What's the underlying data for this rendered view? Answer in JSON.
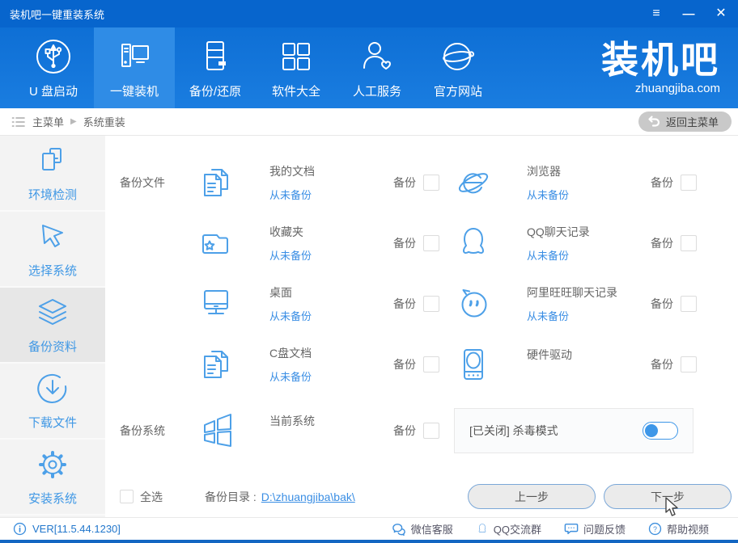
{
  "titlebar": {
    "title": "装机吧一键重装系统"
  },
  "nav": {
    "items": [
      {
        "label": "U 盘启动",
        "icon": "usb-boot-icon",
        "active": false
      },
      {
        "label": "一键装机",
        "icon": "one-click-install-icon",
        "active": true
      },
      {
        "label": "备份/还原",
        "icon": "backup-restore-icon",
        "active": false
      },
      {
        "label": "软件大全",
        "icon": "software-collection-icon",
        "active": false
      },
      {
        "label": "人工服务",
        "icon": "human-service-icon",
        "active": false
      },
      {
        "label": "官方网站",
        "icon": "official-website-icon",
        "active": false
      }
    ],
    "logo": {
      "text": "装机吧",
      "domain": "zhuangjiba.com"
    }
  },
  "breadcrumb": {
    "root": "主菜单",
    "current": "系统重装",
    "back": "返回主菜单"
  },
  "sidebar": [
    {
      "label": "环境检测",
      "icon": "environment-check-icon",
      "active": false
    },
    {
      "label": "选择系统",
      "icon": "select-system-icon",
      "active": false
    },
    {
      "label": "备份资料",
      "icon": "backup-data-icon",
      "active": true
    },
    {
      "label": "下载文件",
      "icon": "download-files-icon",
      "active": false
    },
    {
      "label": "安装系统",
      "icon": "install-system-icon",
      "active": false
    }
  ],
  "content": {
    "files_section": "备份文件",
    "system_section": "备份系统",
    "backup": "备份",
    "items": [
      {
        "title": "我的文档",
        "status": "从未备份",
        "icon": "documents-icon"
      },
      {
        "title": "浏览器",
        "status": "从未备份",
        "icon": "browser-icon"
      },
      {
        "title": "收藏夹",
        "status": "从未备份",
        "icon": "favorites-folder-icon"
      },
      {
        "title": "QQ聊天记录",
        "status": "从未备份",
        "icon": "qq-icon"
      },
      {
        "title": "桌面",
        "status": "从未备份",
        "icon": "desktop-icon"
      },
      {
        "title": "阿里旺旺聊天记录",
        "status": "从未备份",
        "icon": "wangwang-icon"
      },
      {
        "title": "C盘文档",
        "status": "从未备份",
        "icon": "c-drive-docs-icon"
      },
      {
        "title": "硬件驱动",
        "status": "",
        "icon": "hardware-driver-icon"
      },
      {
        "title": "当前系统",
        "status": "",
        "icon": "windows-icon"
      }
    ],
    "antivirus": {
      "label": "[已关闭] 杀毒模式",
      "state": "off"
    },
    "select_all": "全选",
    "dir_label": "备份目录 :",
    "dir_path": "D:\\zhuangjiba\\bak\\",
    "prev": "上一步",
    "next": "下一步"
  },
  "footer": {
    "version": "VER[11.5.44.1230]",
    "links": [
      {
        "label": "微信客服",
        "icon": "wechat-icon"
      },
      {
        "label": "QQ交流群",
        "icon": "qq-group-icon"
      },
      {
        "label": "问题反馈",
        "icon": "feedback-icon"
      },
      {
        "label": "帮助视频",
        "icon": "help-video-icon"
      }
    ]
  },
  "colors": {
    "titlebar": "#0765cd",
    "nav": "#1478dc",
    "nav_selected": "#2f8ce6",
    "link": "#3a8ee4",
    "footer_border": "#1366c2"
  }
}
